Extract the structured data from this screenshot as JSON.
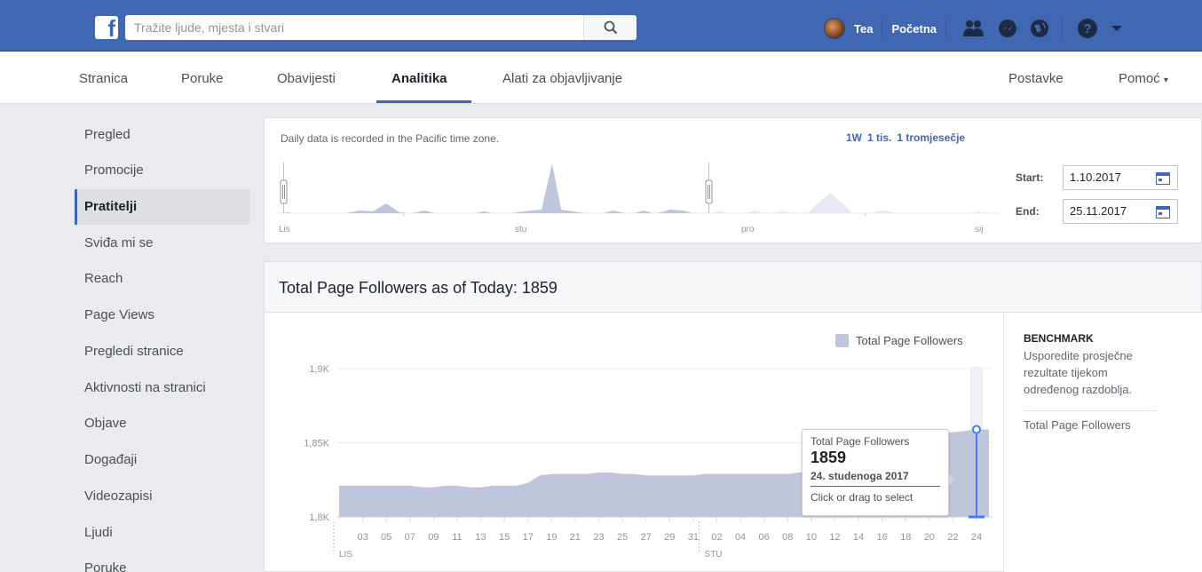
{
  "topbar": {
    "search_placeholder": "Tražite ljude, mjesta i stvari",
    "user_name": "Tea",
    "home_label": "Početna",
    "icons": [
      "friends-icon",
      "messenger-icon",
      "globe-icon",
      "help-icon",
      "dropdown-arrow-icon"
    ]
  },
  "pagenav": {
    "items": [
      "Stranica",
      "Poruke",
      "Obavijesti",
      "Analitika",
      "Alati za objavljivanje"
    ],
    "active": "Analitika",
    "settings_label": "Postavke",
    "help_label": "Pomoć",
    "help_arrow": "▾"
  },
  "sidebar": {
    "items": [
      "Pregled",
      "Promocije",
      "Pratitelji",
      "Sviđa mi se",
      "Reach",
      "Page Views",
      "Pregledi stranice",
      "Aktivnosti na stranici",
      "Objave",
      "Događaji",
      "Videozapisi",
      "Ljudi",
      "Poruke"
    ],
    "active": "Pratitelji"
  },
  "range": {
    "timezone_note": "Daily data is recorded in the Pacific time zone.",
    "links": [
      "1W",
      "1 tis.",
      "1 tromjesečje"
    ],
    "start_label": "Start:",
    "start_value": "1.10.2017",
    "end_label": "End:",
    "end_value": "25.11.2017",
    "overview_month_labels": [
      "Lis",
      "stu",
      "pro",
      "sij"
    ]
  },
  "main": {
    "title": "Total Page Followers as of Today: 1859",
    "legend_label": "Total Page Followers",
    "colors": {
      "area": "#bfc6dc",
      "highlight": "#4080ff",
      "accent": "#4267b2"
    }
  },
  "benchmark": {
    "title": "BENCHMARK",
    "description": "Usporedite prosječne rezultate tijekom određenog razdoblja.",
    "metric": "Total Page Followers"
  },
  "tooltip": {
    "label": "Total Page Followers",
    "value": "1859",
    "date": "24. studenoga 2017",
    "hint": "Click or drag to select"
  },
  "chart_data": {
    "type": "area",
    "title": "Total Page Followers as of Today: 1859",
    "ylim": [
      1800,
      1900
    ],
    "y_ticks": [
      1800,
      1850,
      1900
    ],
    "y_tick_labels": [
      "1,8K",
      "1,85K",
      "1,9K"
    ],
    "x_tick_labels": [
      "03",
      "05",
      "07",
      "09",
      "11",
      "13",
      "15",
      "17",
      "19",
      "21",
      "23",
      "25",
      "27",
      "29",
      "31",
      "02",
      "04",
      "06",
      "08",
      "10",
      "12",
      "14",
      "16",
      "18",
      "20",
      "22",
      "24"
    ],
    "month_labels": [
      "LIS",
      "STU"
    ],
    "grid": true,
    "legend": "top-right",
    "series": [
      {
        "name": "Total Page Followers",
        "x": [
          "2017-10-01",
          "2017-10-02",
          "2017-10-03",
          "2017-10-04",
          "2017-10-05",
          "2017-10-06",
          "2017-10-07",
          "2017-10-08",
          "2017-10-09",
          "2017-10-10",
          "2017-10-11",
          "2017-10-12",
          "2017-10-13",
          "2017-10-14",
          "2017-10-15",
          "2017-10-16",
          "2017-10-17",
          "2017-10-18",
          "2017-10-19",
          "2017-10-20",
          "2017-10-21",
          "2017-10-22",
          "2017-10-23",
          "2017-10-24",
          "2017-10-25",
          "2017-10-26",
          "2017-10-27",
          "2017-10-28",
          "2017-10-29",
          "2017-10-30",
          "2017-10-31",
          "2017-11-01",
          "2017-11-02",
          "2017-11-03",
          "2017-11-04",
          "2017-11-05",
          "2017-11-06",
          "2017-11-07",
          "2017-11-08",
          "2017-11-09",
          "2017-11-10",
          "2017-11-11",
          "2017-11-12",
          "2017-11-13",
          "2017-11-14",
          "2017-11-15",
          "2017-11-16",
          "2017-11-17",
          "2017-11-18",
          "2017-11-19",
          "2017-11-20",
          "2017-11-21",
          "2017-11-22",
          "2017-11-23",
          "2017-11-24"
        ],
        "values": [
          1821,
          1821,
          1821,
          1821,
          1821,
          1821,
          1821,
          1820,
          1820,
          1821,
          1821,
          1820,
          1820,
          1821,
          1821,
          1821,
          1823,
          1828,
          1829,
          1829,
          1829,
          1829,
          1830,
          1830,
          1829,
          1829,
          1828,
          1828,
          1828,
          1828,
          1828,
          1829,
          1829,
          1829,
          1829,
          1829,
          1829,
          1829,
          1829,
          1830,
          1830,
          1830,
          1831,
          1830,
          1851,
          1851,
          1852,
          1853,
          1853,
          1854,
          1855,
          1857,
          1857,
          1858,
          1859
        ]
      }
    ],
    "selected_point": {
      "x": "2017-11-24",
      "value": 1859
    }
  }
}
